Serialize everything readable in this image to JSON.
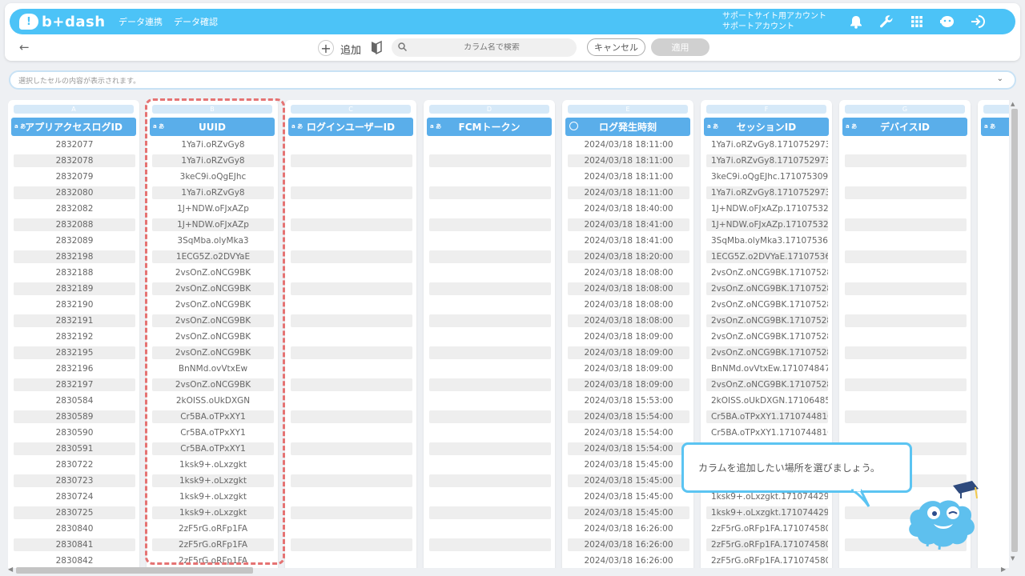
{
  "app": {
    "logo_text": "b+dash",
    "logo_mark": "!"
  },
  "nav": {
    "items": [
      "データ連携",
      "データ確認"
    ]
  },
  "account": {
    "line1": "サポートサイト用アカウント",
    "line2": "サポートアカウント"
  },
  "header_icons": [
    "bell-icon",
    "wrench-icon",
    "apps-grid-icon",
    "chat-bot-icon",
    "logout-icon"
  ],
  "toolbar": {
    "add_label": "追加",
    "search_placeholder": "カラム名で検索",
    "cancel_label": "キャンセル",
    "apply_label": "適用"
  },
  "preview": {
    "placeholder": "選択したセルの内容が表示されます。"
  },
  "columns": [
    {
      "letter": "A",
      "name": "アプリアクセスログID",
      "type": "text"
    },
    {
      "letter": "B",
      "name": "UUID",
      "type": "text"
    },
    {
      "letter": "C",
      "name": "ログインユーザーID",
      "type": "text"
    },
    {
      "letter": "D",
      "name": "FCMトークン",
      "type": "text"
    },
    {
      "letter": "E",
      "name": "ログ発生時刻",
      "type": "datetime"
    },
    {
      "letter": "F",
      "name": "セッションID",
      "type": "text"
    },
    {
      "letter": "G",
      "name": "デバイスID",
      "type": "text"
    },
    {
      "letter": "",
      "name": "",
      "type": "text"
    }
  ],
  "rows": [
    [
      "2832077",
      "1Ya7i.oRZvGy8",
      "",
      "",
      "2024/03/18 18:11:00",
      "1Ya7i.oRZvGy8.1710752973..."
    ],
    [
      "2832078",
      "1Ya7i.oRZvGy8",
      "",
      "",
      "2024/03/18 18:11:00",
      "1Ya7i.oRZvGy8.1710752973..."
    ],
    [
      "2832079",
      "3keC9i.oQgEJhc",
      "",
      "",
      "2024/03/18 18:11:00",
      "3keC9i.oQgEJhc.171075309..."
    ],
    [
      "2832080",
      "1Ya7i.oRZvGy8",
      "",
      "",
      "2024/03/18 18:11:00",
      "1Ya7i.oRZvGy8.1710752973..."
    ],
    [
      "2832082",
      "1J+NDW.oFJxAZp",
      "",
      "",
      "2024/03/18 18:40:00",
      "1J+NDW.oFJxAZp.17107532..."
    ],
    [
      "2832088",
      "1J+NDW.oFJxAZp",
      "",
      "",
      "2024/03/18 18:41:00",
      "1J+NDW.oFJxAZp.17107532..."
    ],
    [
      "2832089",
      "3SqMba.olyMka3",
      "",
      "",
      "2024/03/18 18:41:00",
      "3SqMba.olyMka3.171075360..."
    ],
    [
      "2832198",
      "1ECG5Z.o2DVYaE",
      "",
      "",
      "2024/03/18 18:20:00",
      "1ECG5Z.o2DVYaE.17107536..."
    ],
    [
      "2832188",
      "2vsOnZ.oNCG9BK",
      "",
      "",
      "2024/03/18 18:08:00",
      "2vsOnZ.oNCG9BK.17107528..."
    ],
    [
      "2832189",
      "2vsOnZ.oNCG9BK",
      "",
      "",
      "2024/03/18 18:08:00",
      "2vsOnZ.oNCG9BK.17107528..."
    ],
    [
      "2832190",
      "2vsOnZ.oNCG9BK",
      "",
      "",
      "2024/03/18 18:08:00",
      "2vsOnZ.oNCG9BK.17107528..."
    ],
    [
      "2832191",
      "2vsOnZ.oNCG9BK",
      "",
      "",
      "2024/03/18 18:08:00",
      "2vsOnZ.oNCG9BK.17107528..."
    ],
    [
      "2832192",
      "2vsOnZ.oNCG9BK",
      "",
      "",
      "2024/03/18 18:09:00",
      "2vsOnZ.oNCG9BK.17107528..."
    ],
    [
      "2832195",
      "2vsOnZ.oNCG9BK",
      "",
      "",
      "2024/03/18 18:09:00",
      "2vsOnZ.oNCG9BK.17107528..."
    ],
    [
      "2832196",
      "BnNMd.ovVtxEw",
      "",
      "",
      "2024/03/18 18:09:00",
      "BnNMd.ovVtxEw.171074847..."
    ],
    [
      "2832197",
      "2vsOnZ.oNCG9BK",
      "",
      "",
      "2024/03/18 18:09:00",
      "2vsOnZ.oNCG9BK.17107528..."
    ],
    [
      "2830584",
      "2kOISS.oUkDXGN",
      "",
      "",
      "2024/03/18 15:53:00",
      "2kOISS.oUkDXGN.171064853..."
    ],
    [
      "2830589",
      "Cr5BA.oTPxXY1",
      "",
      "",
      "2024/03/18 15:54:00",
      "Cr5BA.oTPxXY1.1710744816..."
    ],
    [
      "2830590",
      "Cr5BA.oTPxXY1",
      "",
      "",
      "2024/03/18 15:54:00",
      "Cr5BA.oTPxXY1.1710744816..."
    ],
    [
      "2830591",
      "Cr5BA.oTPxXY1",
      "",
      "",
      "2024/03/18 15:54:00",
      ""
    ],
    [
      "2830722",
      "1ksk9+.oLxzgkt",
      "",
      "",
      "2024/03/18 15:45:00",
      ""
    ],
    [
      "2830723",
      "1ksk9+.oLxzgkt",
      "",
      "",
      "2024/03/18 15:45:00",
      ""
    ],
    [
      "2830724",
      "1ksk9+.oLxzgkt",
      "",
      "",
      "2024/03/18 15:45:00",
      "1ksk9+.oLxzgkt.171074429..."
    ],
    [
      "2830725",
      "1ksk9+.oLxzgkt",
      "",
      "",
      "2024/03/18 15:45:00",
      "1ksk9+.oLxzgkt.171074429..."
    ],
    [
      "2830840",
      "2zF5rG.oRFp1FA",
      "",
      "",
      "2024/03/18 16:26:00",
      "2zF5rG.oRFp1FA.171074580..."
    ],
    [
      "2830841",
      "2zF5rG.oRFp1FA",
      "",
      "",
      "2024/03/18 16:26:00",
      "2zF5rG.oRFp1FA.171074580..."
    ],
    [
      "2830842",
      "2zF5rG.oRFp1FA",
      "",
      "",
      "2024/03/18 16:26:00",
      "2zF5rG.oRFp1FA.171074580..."
    ]
  ],
  "tooltip": {
    "text": "カラムを追加したい場所を選びましょう。"
  },
  "colors": {
    "header": "#4cc3f7",
    "column_head": "#5aaeea",
    "highlight": "#e57373",
    "tooltip_border": "#5bc4f2"
  }
}
